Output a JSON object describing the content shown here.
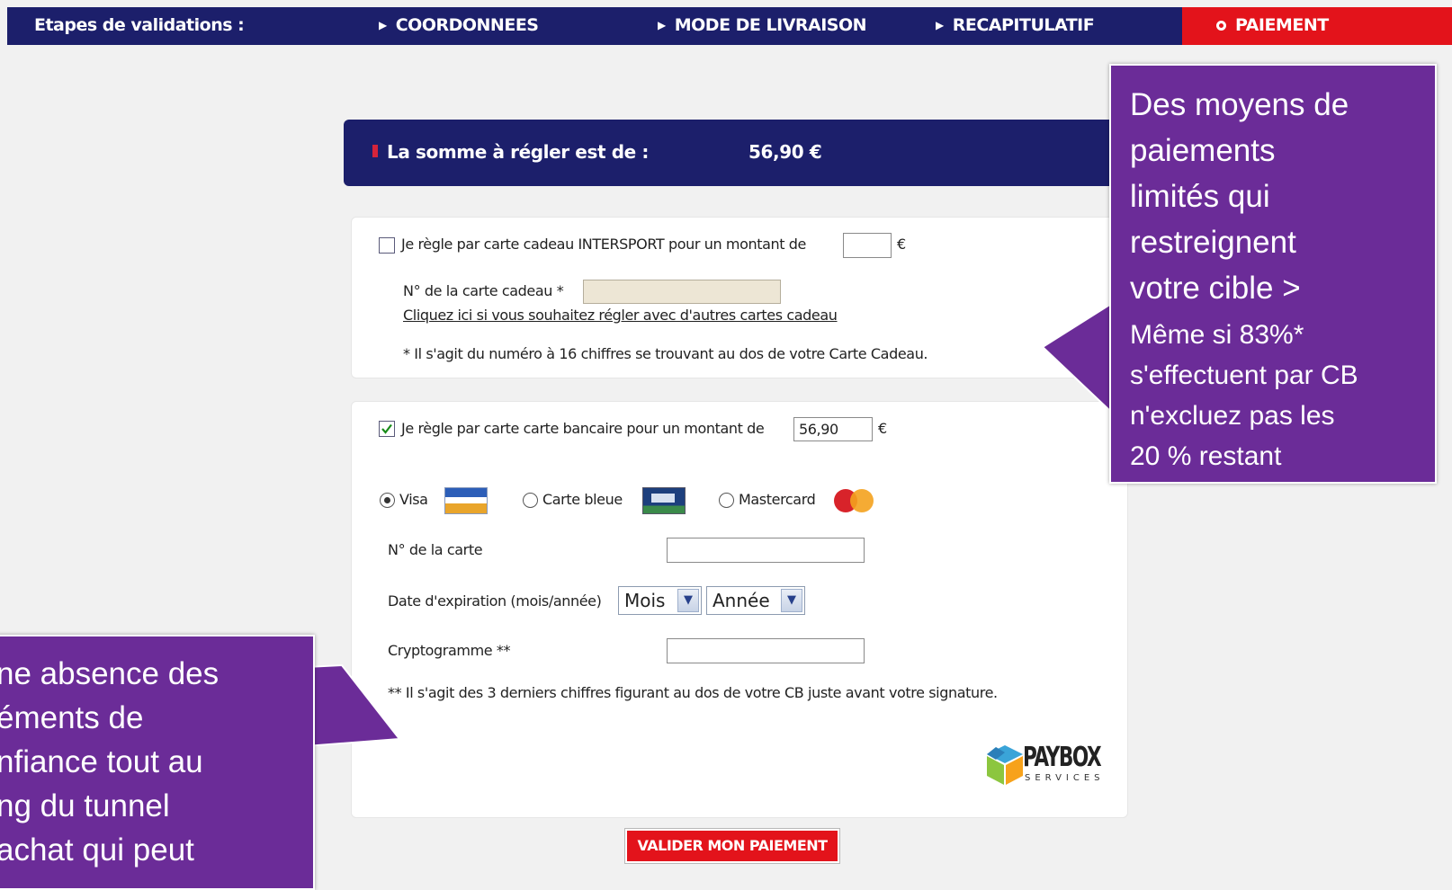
{
  "steps": {
    "label": "Etapes de validations :",
    "items": [
      "COORDONNEES",
      "MODE DE LIVRAISON",
      "RECAPITULATIF"
    ],
    "active": "PAIEMENT"
  },
  "amount": {
    "label": "La somme à régler est de :",
    "value": "56,90 €"
  },
  "gift_card": {
    "text": "Je règle par carte cadeau INTERSPORT pour un montant de",
    "currency": "€",
    "number_label": "N° de la carte cadeau *",
    "link": "Cliquez ici si vous souhaitez régler avec d'autres cartes cadeau",
    "note": "* Il s'agit du numéro à 16 chiffres se trouvant au dos de votre Carte Cadeau."
  },
  "bank_card": {
    "text": "Je règle par carte carte bancaire pour un montant de",
    "amount": "56,90",
    "currency": "€",
    "options": [
      "Visa",
      "Carte bleue",
      "Mastercard"
    ],
    "number_label": "N° de la carte",
    "expiry_label": "Date d'expiration (mois/année)",
    "month": "Mois",
    "year": "Année",
    "cvv_label": "Cryptogramme **",
    "cvv_note": "** Il s'agit des 3 derniers chiffres figurant au dos de votre CB juste avant votre signature.",
    "paybox": "PAYBOX",
    "paybox_sub": "SERVICES"
  },
  "validate": "VALIDER MON PAIEMENT",
  "callout_right": {
    "big": [
      "Des moyens de",
      "paiements",
      "limités qui",
      "restreignent",
      "votre cible >"
    ],
    "small": [
      "Même si 83%*",
      "s'effectuent par CB",
      "n'excluez pas les",
      "20 % restant"
    ]
  },
  "callout_left": [
    "ne absence des",
    "éments de",
    "nfiance tout au",
    "ng du tunnel",
    "achat qui peut"
  ],
  "colors": {
    "navy": "#1c1f6b",
    "red": "#e3131b",
    "purple": "#6b2c98"
  }
}
